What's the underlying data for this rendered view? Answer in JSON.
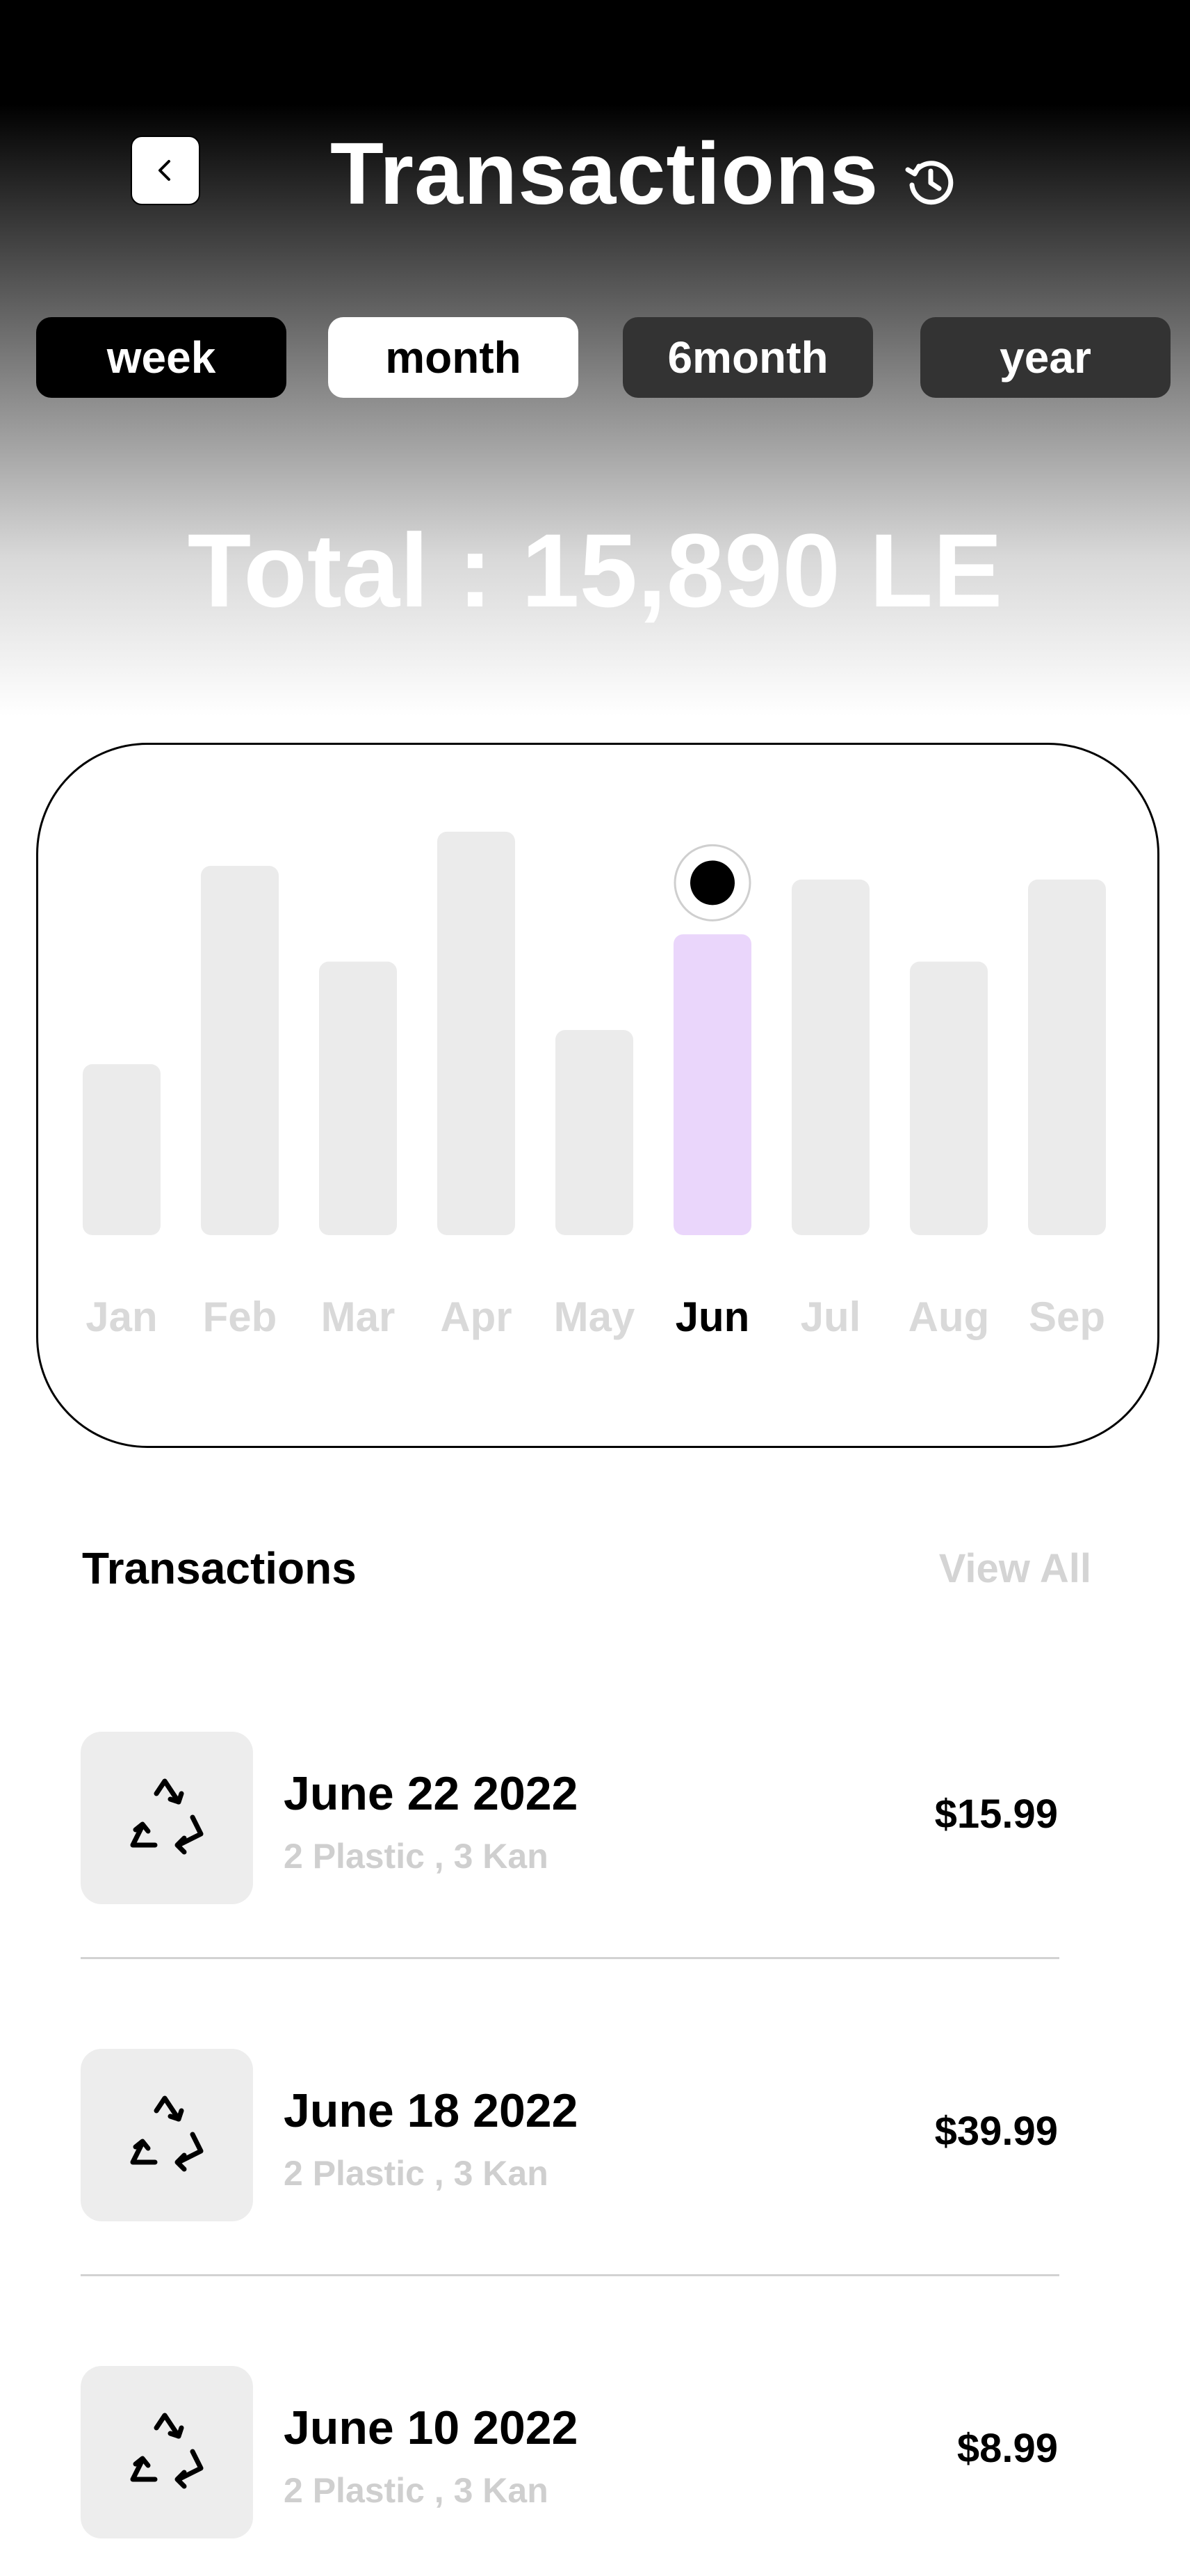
{
  "header": {
    "title": "Transactions"
  },
  "period_tabs": [
    {
      "label": "week",
      "style": "black"
    },
    {
      "label": "month",
      "style": "white"
    },
    {
      "label": "6month",
      "style": "dark"
    },
    {
      "label": "year",
      "style": "dark"
    }
  ],
  "total_text": "Total : 15,890 LE",
  "chart_data": {
    "type": "bar",
    "categories": [
      "Jan",
      "Feb",
      "Mar",
      "Apr",
      "May",
      "Jun",
      "Jul",
      "Aug",
      "Sep"
    ],
    "values": [
      25,
      54,
      40,
      59,
      30,
      44,
      52,
      40,
      52
    ],
    "selected": "Jun",
    "colors": {
      "bar": "#ebebeb",
      "selected_bar": "#ead6fb",
      "label": "#d9d9d9",
      "selected_label": "#000000"
    }
  },
  "transactions_section": {
    "title": "Transactions",
    "view_all": "View All"
  },
  "transactions": [
    {
      "date": "June 22 2022",
      "items": "2 Plastic , 3 Kan",
      "amount": "$15.99",
      "icon": "recycle-icon"
    },
    {
      "date": "June 18 2022",
      "items": "2 Plastic , 3 Kan",
      "amount": "$39.99",
      "icon": "recycle-icon"
    },
    {
      "date": "June 10 2022",
      "items": "2 Plastic , 3 Kan",
      "amount": "$8.99",
      "icon": "recycle-icon"
    }
  ]
}
